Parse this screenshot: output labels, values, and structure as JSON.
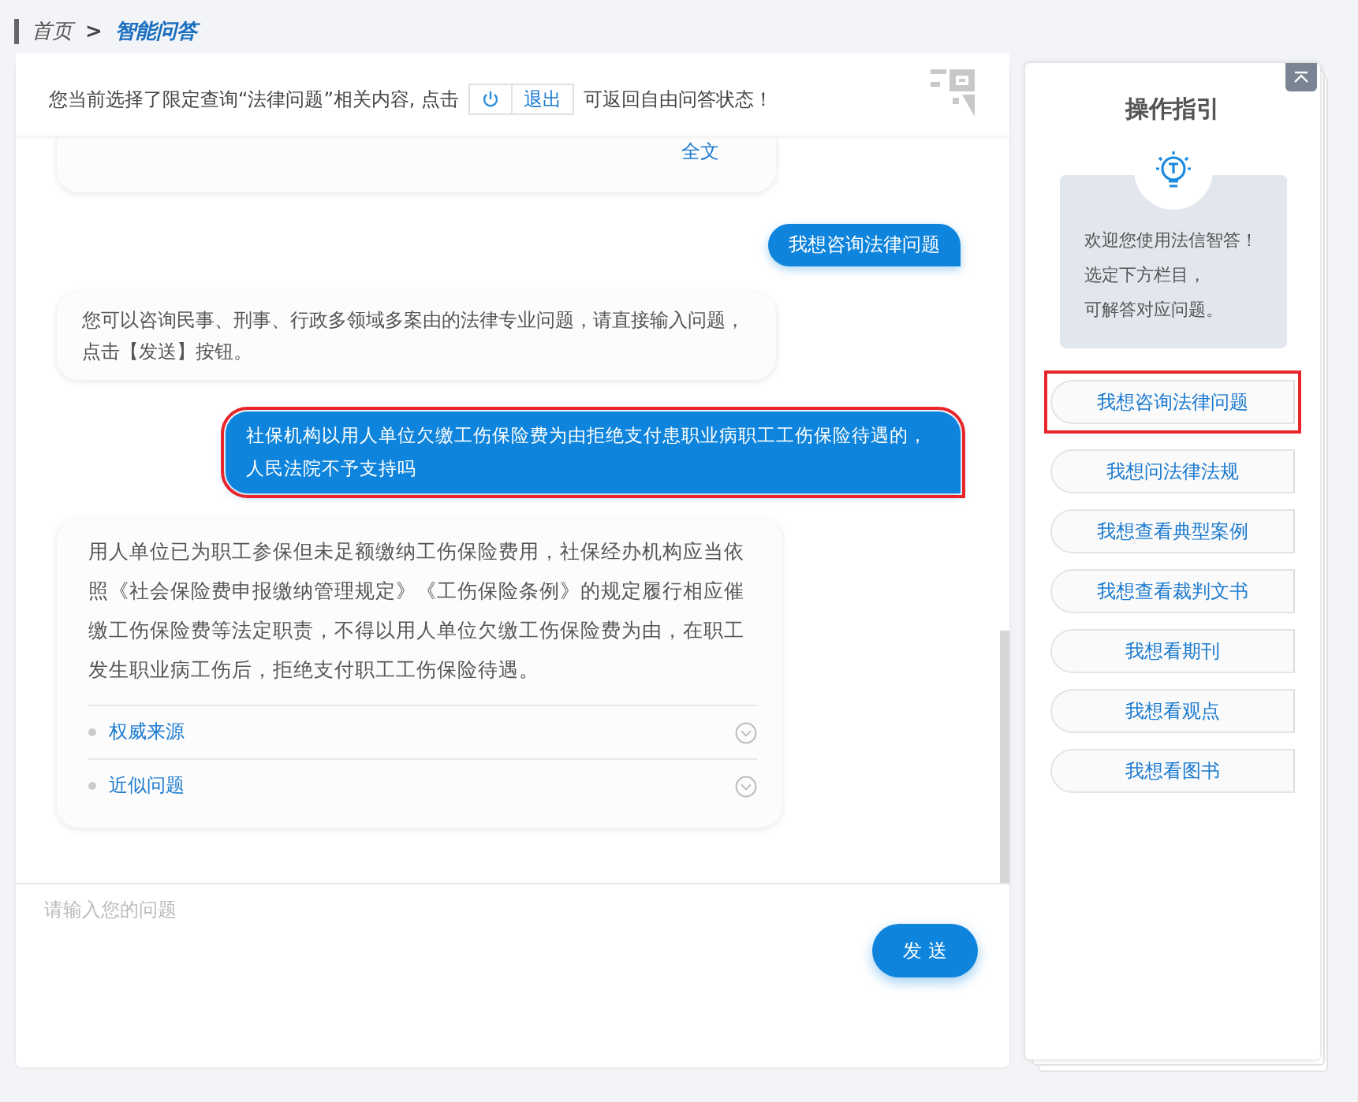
{
  "breadcrumb": {
    "items": [
      {
        "label": "首页",
        "selected": false
      },
      {
        "label": "智能问答",
        "selected": true
      }
    ],
    "separator": ">"
  },
  "notice": {
    "before": "您当前选择了限定查询“法律问题”相关内容, 点击",
    "exit_label": "退出",
    "after": "可返回自由问答状态！"
  },
  "messages": [
    {
      "kind": "partial",
      "link": "全文"
    },
    {
      "kind": "user",
      "text": "我想咨询法律问题",
      "highlighted": false
    },
    {
      "kind": "bot",
      "text": "您可以咨询民事、刑事、行政多领域多案由的法律专业问题，请直接输入问题，点击【发送】按钮。"
    },
    {
      "kind": "user",
      "text": "社保机构以用人单位欠缴工伤保险费为由拒绝支付患职业病职工工伤保险待遇的，人民法院不予支持吗",
      "highlighted": true
    },
    {
      "kind": "answer",
      "text": "用人单位已为职工参保但未足额缴纳工伤保险费用，社保经办机构应当依照《社会保险费申报缴纳管理规定》《工伤保险条例》的规定履行相应催缴工伤保险费等法定职责，不得以用人单位欠缴工伤保险费为由，在职工发生职业病工伤后，拒绝支付职工工伤保险待遇。",
      "sections": [
        {
          "label": "权威来源",
          "expanded": false
        },
        {
          "label": "近似问题",
          "expanded": false
        }
      ]
    }
  ],
  "input": {
    "placeholder": "请输入您的问题",
    "send_label": "发 送"
  },
  "guide": {
    "title": "操作指引",
    "intro": [
      "欢迎您使用法信智答！",
      "选定下方栏目，",
      "可解答对应问题。"
    ],
    "items": [
      {
        "label": "我想咨询法律问题",
        "highlighted": true
      },
      {
        "label": "我想问法律法规",
        "highlighted": false
      },
      {
        "label": "我想查看典型案例",
        "highlighted": false
      },
      {
        "label": "我想查看裁判文书",
        "highlighted": false
      },
      {
        "label": "我想看期刊",
        "highlighted": false
      },
      {
        "label": "我想看观点",
        "highlighted": false
      },
      {
        "label": "我想看图书",
        "highlighted": false
      }
    ]
  }
}
